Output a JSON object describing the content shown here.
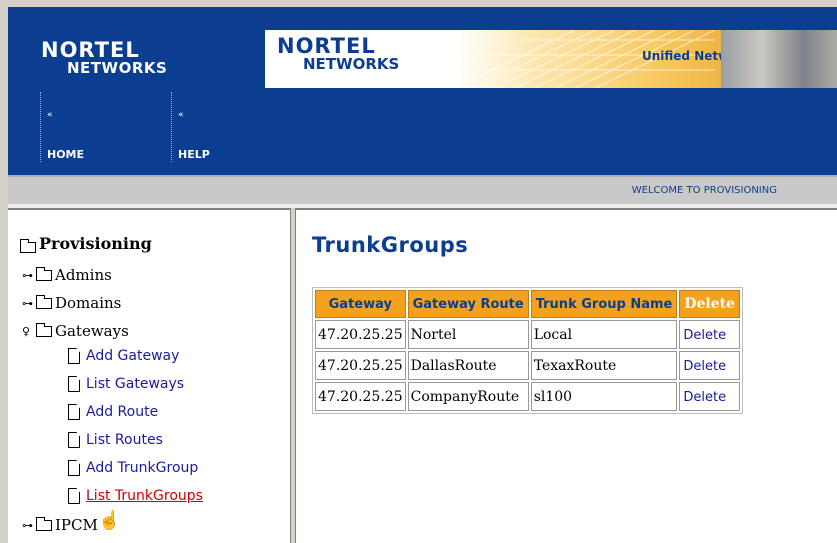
{
  "header": {
    "logo_line1": "NORTEL",
    "logo_line2": "NETWORKS",
    "banner_logo_line1": "NORTEL",
    "banner_logo_line2": "NETWORKS",
    "banner_text": "Unified Network",
    "nav": [
      {
        "label": "HOME",
        "arrow": "«"
      },
      {
        "label": "HELP",
        "arrow": "«"
      }
    ],
    "welcome": "WELCOME TO PROVISIONING"
  },
  "sidebar": {
    "root": "Provisioning",
    "nodes": [
      {
        "label": "Admins",
        "state": "collapsed"
      },
      {
        "label": "Domains",
        "state": "collapsed"
      },
      {
        "label": "Gateways",
        "state": "expanded"
      },
      {
        "label": "IPCM",
        "state": "collapsed"
      }
    ],
    "leaves": [
      {
        "label": "Add Gateway"
      },
      {
        "label": "List Gateways"
      },
      {
        "label": "Add Route"
      },
      {
        "label": "List Routes"
      },
      {
        "label": "Add TrunkGroup"
      },
      {
        "label": "List TrunkGroups"
      }
    ]
  },
  "main": {
    "title": "TrunkGroups",
    "columns": [
      "Gateway",
      "Gateway Route",
      "Trunk Group Name",
      "Delete"
    ],
    "rows": [
      {
        "gateway": "47.20.25.25",
        "route": "Nortel",
        "trunk": "Local",
        "action": "Delete"
      },
      {
        "gateway": "47.20.25.25",
        "route": "DallasRoute",
        "trunk": "TexaxRoute",
        "action": "Delete"
      },
      {
        "gateway": "47.20.25.25",
        "route": "CompanyRoute",
        "trunk": "sl100",
        "action": "Delete"
      }
    ]
  },
  "colors": {
    "header_blue": "#0b3d91",
    "table_header_orange": "#f4a21d",
    "link_blue": "#1a1aa0",
    "active_link_red": "#cc0000"
  }
}
